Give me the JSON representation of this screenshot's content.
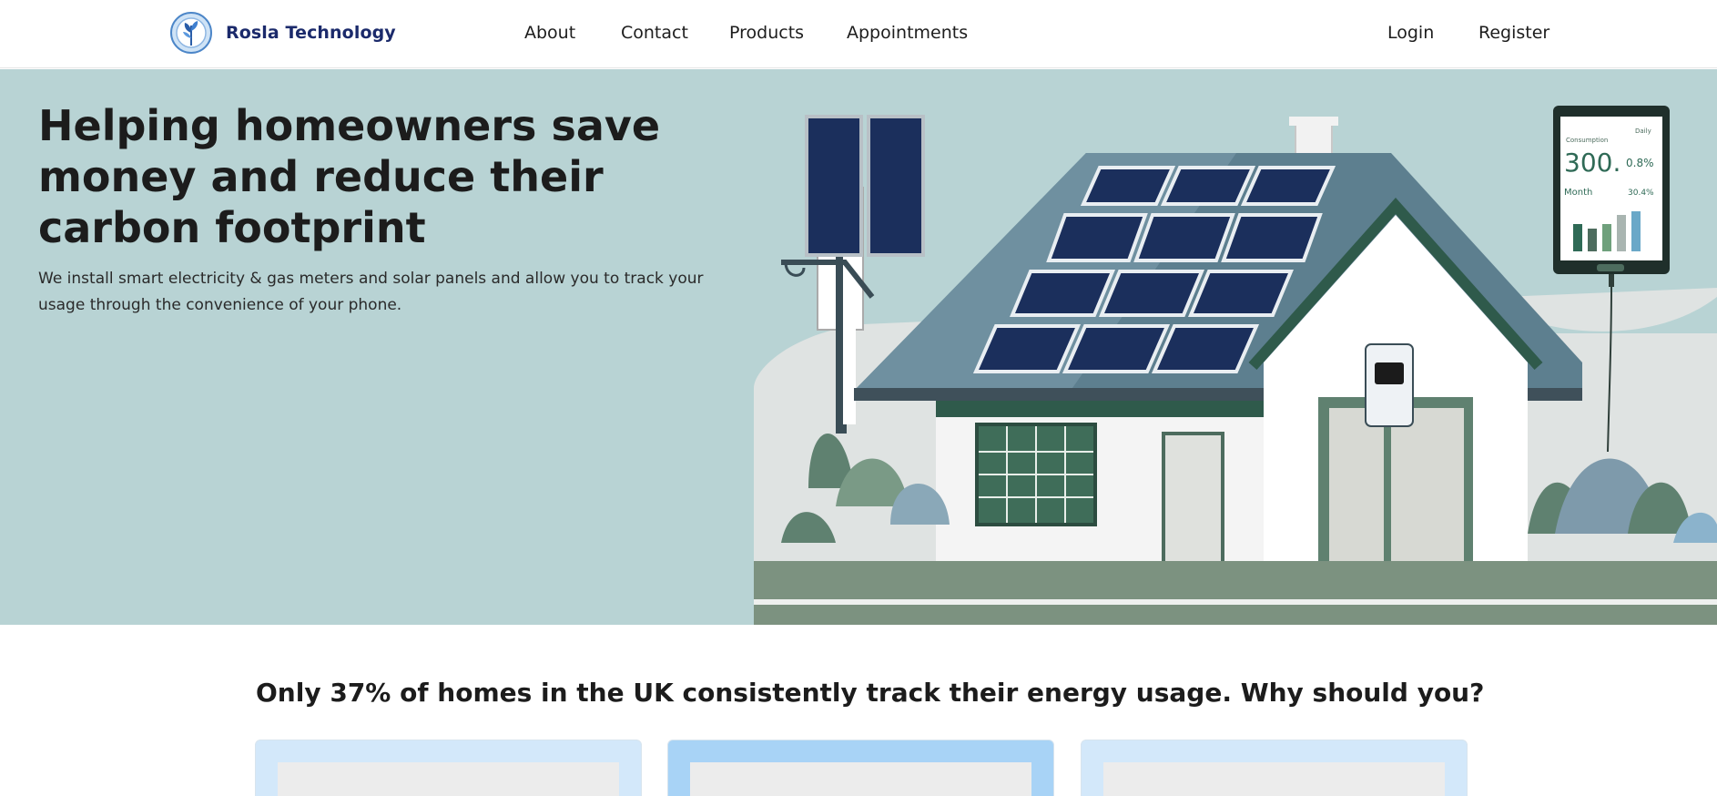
{
  "navbar": {
    "brand_name": "Rosla Technology",
    "logo_icon": "tree-leaf-logo-icon",
    "links": [
      {
        "label": "About"
      },
      {
        "label": "Contact"
      },
      {
        "label": "Products"
      },
      {
        "label": "Appointments"
      }
    ],
    "auth": {
      "login_label": "Login",
      "register_label": "Register"
    }
  },
  "hero": {
    "title": "Helping homeowners save money and reduce their carbon footprint",
    "text": "We install smart electricity & gas meters and solar panels and allow you to track your usage through the convenience of your phone.",
    "background_color": "#b8d3d4",
    "phone_screen": {
      "top_label": "Consumption",
      "tag": "Daily",
      "big_value": "300.",
      "percent_1": "0.8%",
      "month_label": "Month",
      "percent_2": "30.4%"
    }
  },
  "stats": {
    "heading": "Only 37% of homes in the UK consistently track their energy usage. Why should you?"
  },
  "colors": {
    "brand_text": "#1b2a6b",
    "card_light": "#d3e8fa",
    "card_active": "#a8d3f6",
    "roof": "#5d7f8f",
    "panel": "#1b2f5c",
    "house_green": "#476c5c"
  }
}
